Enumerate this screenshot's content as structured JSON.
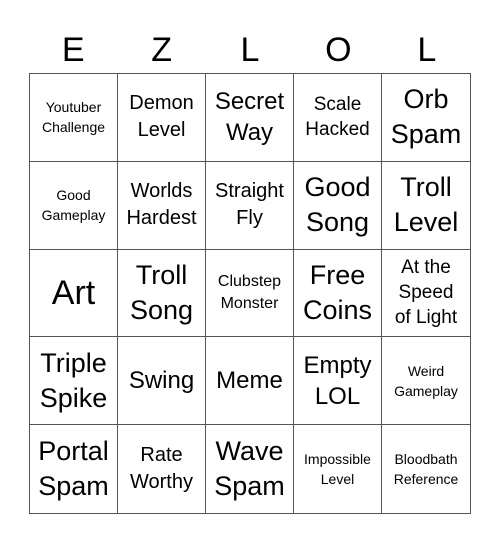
{
  "header": {
    "letters": [
      "E",
      "Z",
      "L",
      "O",
      "L"
    ]
  },
  "board": {
    "rows": [
      [
        "Youtuber\nChallenge",
        "Demon\nLevel",
        "Secret\nWay",
        "Scale\nHacked",
        "Orb\nSpam"
      ],
      [
        "Good\nGameplay",
        "Worlds\nHardest",
        "Straight\nFly",
        "Good\nSong",
        "Troll\nLevel"
      ],
      [
        "Art",
        "Troll\nSong",
        "Clubstep\nMonster",
        "Free\nCoins",
        "At the\nSpeed\nof Light"
      ],
      [
        "Triple\nSpike",
        "Swing",
        "Meme",
        "Empty\nLOL",
        "Weird\nGameplay"
      ],
      [
        "Portal\nSpam",
        "Rate\nWorthy",
        "Wave\nSpam",
        "Impossible\nLevel",
        "Bloodbath\nReference"
      ]
    ]
  }
}
